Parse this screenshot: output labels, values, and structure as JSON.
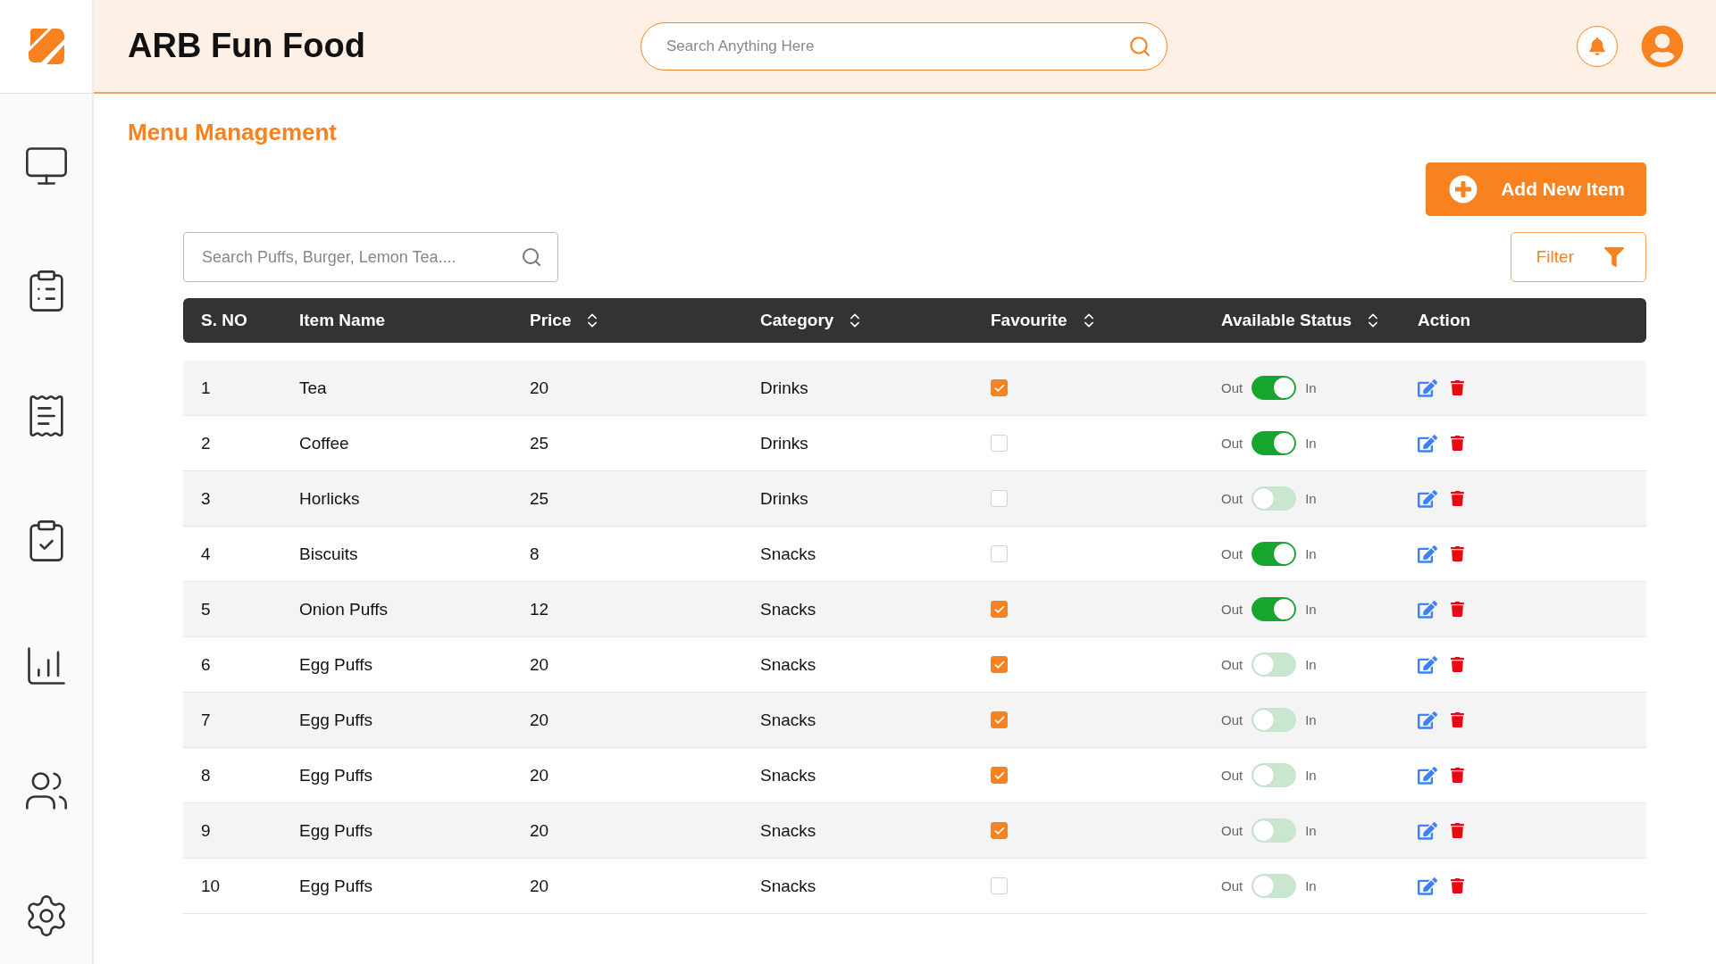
{
  "header": {
    "title": "ARB Fun Food",
    "search": {
      "placeholder": "Search Anything Here"
    }
  },
  "page": {
    "title": "Menu Management",
    "add_button": "Add New Item",
    "filter_button": "Filter",
    "search": {
      "placeholder": "Search Puffs, Burger, Lemon Tea...."
    }
  },
  "table": {
    "columns": [
      {
        "label": "S. NO",
        "sortable": false
      },
      {
        "label": "Item Name",
        "sortable": false
      },
      {
        "label": "Price",
        "sortable": true
      },
      {
        "label": "Category",
        "sortable": true
      },
      {
        "label": "Favourite",
        "sortable": true
      },
      {
        "label": "Available Status",
        "sortable": true
      },
      {
        "label": "Action",
        "sortable": false
      }
    ],
    "rows": [
      {
        "sno": "1",
        "name": "Tea",
        "price": "20",
        "category": "Drinks",
        "favourite": true,
        "available": true,
        "off_label": "Out",
        "on_label": "In"
      },
      {
        "sno": "2",
        "name": "Coffee",
        "price": "25",
        "category": "Drinks",
        "favourite": false,
        "available": true,
        "off_label": "Out",
        "on_label": "In"
      },
      {
        "sno": "3",
        "name": "Horlicks",
        "price": "25",
        "category": "Drinks",
        "favourite": false,
        "available": false,
        "off_label": "Out",
        "on_label": "In"
      },
      {
        "sno": "4",
        "name": "Biscuits",
        "price": "8",
        "category": "Snacks",
        "favourite": false,
        "available": true,
        "off_label": "Out",
        "on_label": "In"
      },
      {
        "sno": "5",
        "name": "Onion Puffs",
        "price": "12",
        "category": "Snacks",
        "favourite": true,
        "available": true,
        "off_label": "Out",
        "on_label": "In"
      },
      {
        "sno": "6",
        "name": "Egg Puffs",
        "price": "20",
        "category": "Snacks",
        "favourite": true,
        "available": false,
        "off_label": "Out",
        "on_label": "In"
      },
      {
        "sno": "7",
        "name": "Egg Puffs",
        "price": "20",
        "category": "Snacks",
        "favourite": true,
        "available": false,
        "off_label": "Out",
        "on_label": "In"
      },
      {
        "sno": "8",
        "name": "Egg Puffs",
        "price": "20",
        "category": "Snacks",
        "favourite": true,
        "available": false,
        "off_label": "Out",
        "on_label": "In"
      },
      {
        "sno": "9",
        "name": "Egg Puffs",
        "price": "20",
        "category": "Snacks",
        "favourite": true,
        "available": false,
        "off_label": "Out",
        "on_label": "In"
      },
      {
        "sno": "10",
        "name": "Egg Puffs",
        "price": "20",
        "category": "Snacks",
        "favourite": false,
        "available": false,
        "off_label": "Out",
        "on_label": "In"
      }
    ]
  }
}
